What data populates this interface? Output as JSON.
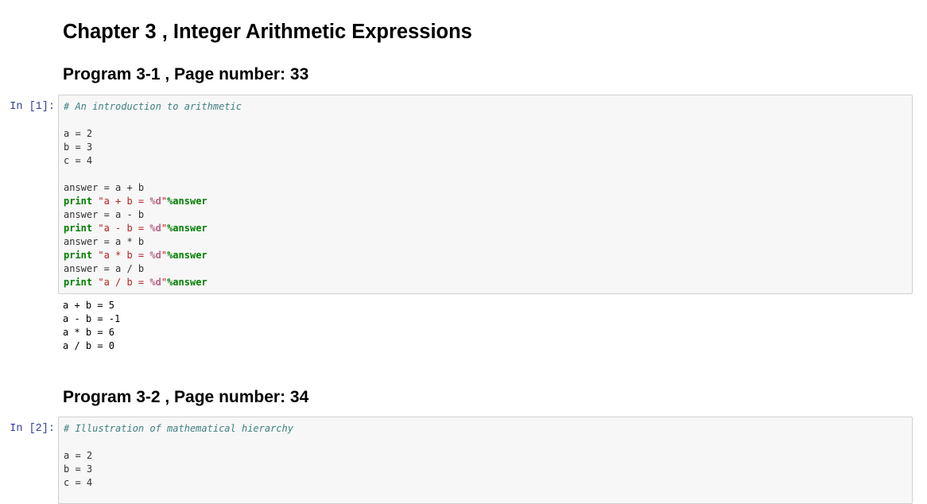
{
  "chapter_title": "Chapter 3 , Integer Arithmetic Expressions",
  "programs": [
    {
      "heading": "Program 3-1 , Page number: 33",
      "prompt": "In [1]:",
      "code": {
        "comment": "# An introduction to arithmetic",
        "assign_a": "a = 2",
        "assign_b": "b = 3",
        "assign_c": "c = 4",
        "ops": [
          {
            "assign": "answer = a + b",
            "kw": "print",
            "str_open": "\"a + b = ",
            "fmt": "%d",
            "str_close": "\"",
            "tail": "%answer"
          },
          {
            "assign": "answer = a - b",
            "kw": "print",
            "str_open": "\"a - b = ",
            "fmt": "%d",
            "str_close": "\"",
            "tail": "%answer"
          },
          {
            "assign": "answer = a * b",
            "kw": "print",
            "str_open": "\"a * b = ",
            "fmt": "%d",
            "str_close": "\"",
            "tail": "%answer"
          },
          {
            "assign": "answer = a / b",
            "kw": "print",
            "str_open": "\"a / b = ",
            "fmt": "%d",
            "str_close": "\"",
            "tail": "%answer"
          }
        ]
      },
      "output": [
        "a + b = 5",
        "a - b = -1",
        "a * b = 6",
        "a / b = 0"
      ]
    },
    {
      "heading": "Program 3-2 , Page number: 34",
      "prompt": "In [2]:",
      "code": {
        "comment": "# Illustration of mathematical hierarchy",
        "assign_a": "a = 2",
        "assign_b": "b = 3",
        "assign_c": "c = 4"
      }
    }
  ],
  "colors": {
    "prompt": "#303f9f",
    "comment": "#408080",
    "keyword": "#008000",
    "string": "#ba2121",
    "format": "#bb6688",
    "cell_bg": "#f7f7f7",
    "cell_border": "#cfcfcf"
  }
}
